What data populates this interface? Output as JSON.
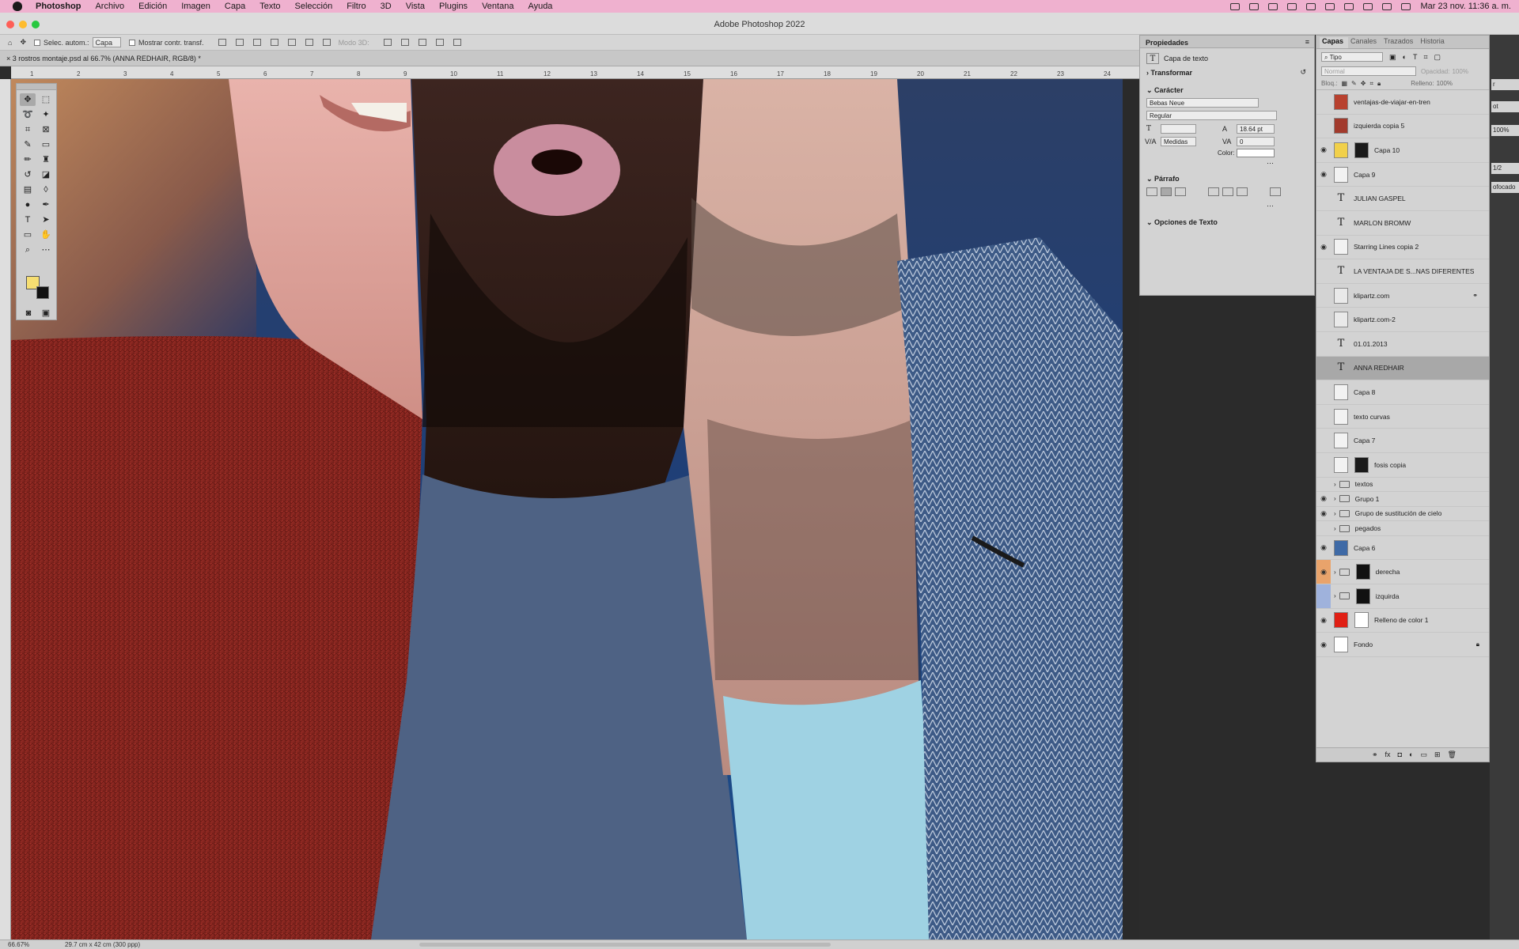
{
  "menubar": {
    "items": [
      "Photoshop",
      "Archivo",
      "Edición",
      "Imagen",
      "Capa",
      "Texto",
      "Selección",
      "Filtro",
      "3D",
      "Vista",
      "Plugins",
      "Ventana",
      "Ayuda"
    ],
    "clock": "Mar 23 nov.  11:36 a. m."
  },
  "window": {
    "title": "Adobe Photoshop 2022"
  },
  "options": {
    "auto_select_label": "Selec. autom.:",
    "auto_select_value": "Capa",
    "transform_label": "Mostrar contr. transf.",
    "mode3d_label": "Modo 3D:"
  },
  "document": {
    "tab_title": "3 rostros montaje.psd al 66.7% (ANNA REDHAIR, RGB/8) *",
    "ruler_numbers": [
      "1",
      "2",
      "3",
      "4",
      "5",
      "6",
      "7",
      "8",
      "9",
      "10",
      "11",
      "12",
      "13",
      "14",
      "15",
      "16",
      "17",
      "18",
      "19",
      "20",
      "21",
      "22",
      "23",
      "24"
    ],
    "zoom": "66.67%",
    "dimensions": "29.7 cm x 42 cm (300 ppp)"
  },
  "properties": {
    "title": "Propiedades",
    "layer_kind": "Capa de texto",
    "transform_section": "Transformar",
    "character_section": "Carácter",
    "font_family": "Bebas Neue",
    "font_style": "Regular",
    "leading": "18.64 pt",
    "kerning": "Medidas",
    "tracking": "0",
    "color_label": "Color:",
    "paragraph_section": "Párrafo",
    "text_options_section": "Opciones de Texto"
  },
  "layers_panel": {
    "tabs": [
      "Capas",
      "Canales",
      "Trazados",
      "Historia"
    ],
    "filter_type": "Tipo",
    "blend_mode": "Normal",
    "opacity_label": "Opacidad:",
    "opacity_value": "100%",
    "lock_label": "Bloq.:",
    "fill_label": "Relleno:",
    "fill_value": "100%",
    "layers": [
      {
        "name": "ventajas-de-viajar-en-tren",
        "visible": false,
        "kind": "image",
        "thumb": "#b8412f"
      },
      {
        "name": "izquierda copia 5",
        "visible": false,
        "kind": "image",
        "thumb": "#a23a2c"
      },
      {
        "name": "Capa 10",
        "visible": true,
        "kind": "mask",
        "thumb": "#f1d04a"
      },
      {
        "name": "Capa 9",
        "visible": true,
        "kind": "pixel",
        "thumb": "#f2f2f2"
      },
      {
        "name": "JULIAN GASPEL",
        "visible": false,
        "kind": "text"
      },
      {
        "name": "MARLON BROMW",
        "visible": false,
        "kind": "text"
      },
      {
        "name": "Starring Lines copia 2",
        "visible": true,
        "kind": "pixel",
        "thumb": "#f2f2f2"
      },
      {
        "name": "LA VENTAJA DE S...NAS DIFERENTES",
        "visible": false,
        "kind": "text"
      },
      {
        "name": "klipartz.com",
        "visible": false,
        "kind": "smart",
        "thumb": "#e9e9e9"
      },
      {
        "name": "klipartz.com-2",
        "visible": false,
        "kind": "smart",
        "thumb": "#e9e9e9"
      },
      {
        "name": "01.01.2013",
        "visible": false,
        "kind": "text"
      },
      {
        "name": "ANNA REDHAIR",
        "visible": false,
        "kind": "text",
        "selected": true
      },
      {
        "name": "Capa 8",
        "visible": false,
        "kind": "pixel",
        "thumb": "#f2f2f2"
      },
      {
        "name": "texto curvas",
        "visible": false,
        "kind": "pixel",
        "thumb": "#f2f2f2"
      },
      {
        "name": "Capa 7",
        "visible": false,
        "kind": "pixel",
        "thumb": "#f2f2f2"
      },
      {
        "name": "fosis copia",
        "visible": false,
        "kind": "mask",
        "thumb": "#f2f2f2"
      },
      {
        "name": "textos",
        "visible": false,
        "kind": "group"
      },
      {
        "name": "Grupo 1",
        "visible": true,
        "kind": "group"
      },
      {
        "name": "Grupo de sustitución de cielo",
        "visible": true,
        "kind": "group"
      },
      {
        "name": "pegados",
        "visible": false,
        "kind": "group"
      },
      {
        "name": "Capa 6",
        "visible": true,
        "kind": "image",
        "thumb": "#3f6aa6"
      },
      {
        "name": "derecha",
        "visible": true,
        "kind": "groupmask",
        "label": "#e9a36b"
      },
      {
        "name": "izquirda",
        "visible": false,
        "kind": "groupmask",
        "label": "#9fb2dc"
      },
      {
        "name": "Relleno de color 1",
        "visible": true,
        "kind": "fill",
        "thumb": "#e01f14"
      },
      {
        "name": "Fondo",
        "visible": true,
        "kind": "background",
        "thumb": "#ffffff"
      }
    ]
  },
  "far_right": {
    "items": [
      "r",
      "ot",
      "100%",
      "1/2",
      "ofocado"
    ]
  },
  "colors": {
    "menubar": "#efb1cf",
    "foreground": "#f6de72",
    "background": "#111111"
  }
}
